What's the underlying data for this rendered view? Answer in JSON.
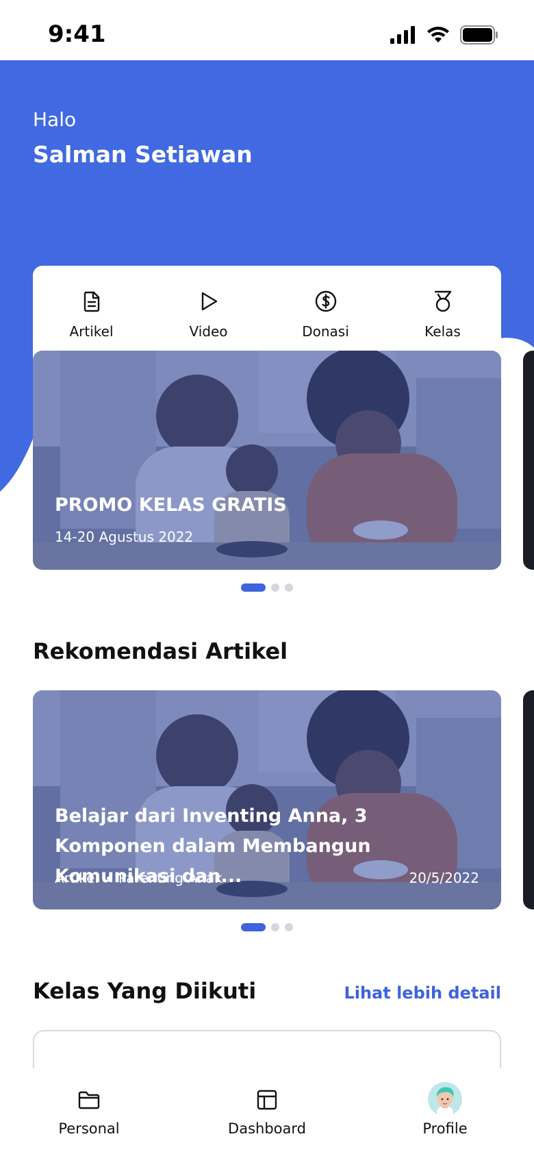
{
  "status_bar": {
    "time": "9:41"
  },
  "header": {
    "greeting": "Halo",
    "username": "Salman Setiawan",
    "background_color": "#4169e1"
  },
  "quick_menu": [
    {
      "label": "Artikel",
      "icon": "document-icon"
    },
    {
      "label": "Video",
      "icon": "play-icon"
    },
    {
      "label": "Donasi",
      "icon": "dollar-circle-icon"
    },
    {
      "label": "Kelas",
      "icon": "medal-icon"
    }
  ],
  "promo_carousel": {
    "title": "PROMO KELAS GRATIS",
    "date": "14-20 Agustus 2022",
    "page_count": 3,
    "active_page": 1
  },
  "recommendations": {
    "title": "Rekomendasi Artikel",
    "article": {
      "title": "Belajar dari Inventing Anna, 3 Komponen dalam Membangun Komunikasi dan...",
      "category": "Artikel",
      "topic": "Parenting Anak",
      "date": "20/5/2022"
    },
    "page_count": 3,
    "active_page": 1
  },
  "classes": {
    "title": "Kelas Yang Diikuti",
    "see_more": "Lihat lebih detail"
  },
  "tab_bar": [
    {
      "label": "Personal",
      "icon": "folder-icon"
    },
    {
      "label": "Dashboard",
      "icon": "layout-icon"
    },
    {
      "label": "Profile",
      "icon": "avatar"
    }
  ],
  "colors": {
    "accent": "#3d63dd",
    "hero_blue": "#4169e1"
  }
}
